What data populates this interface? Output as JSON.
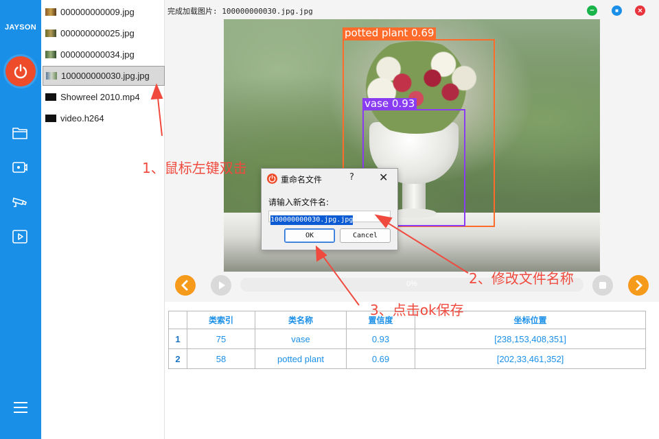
{
  "sidebar": {
    "brand": "JAYSON",
    "icons": [
      "power-icon",
      "folder-icon",
      "camera-icon",
      "cctv-icon",
      "play-icon",
      "menu-icon"
    ],
    "accent": "#1a8fe8",
    "power_color": "#ee4b2b"
  },
  "files": [
    {
      "name": "000000000009.jpg",
      "thumb": "image"
    },
    {
      "name": "000000000025.jpg",
      "thumb": "image"
    },
    {
      "name": "000000000034.jpg",
      "thumb": "image"
    },
    {
      "name": "100000000030.jpg.jpg",
      "thumb": "image",
      "selected": true
    },
    {
      "name": "Showreel 2010.mp4",
      "thumb": "video"
    },
    {
      "name": "video.h264",
      "thumb": "video"
    }
  ],
  "status": "完成加载图片: 100000000030.jpg.jpg",
  "window_buttons": {
    "minimize": "#18b44a",
    "maximize": "#1a8fe8",
    "close": "#e8343c"
  },
  "detections_overlay": [
    {
      "label": "potted plant 0.69",
      "color": "#ff6b2b"
    },
    {
      "label": "vase 0.93",
      "color": "#8a3cf2"
    }
  ],
  "player": {
    "progress_text": "0%",
    "progress": 0
  },
  "table": {
    "headers": [
      "",
      "类索引",
      "类名称",
      "置信度",
      "坐标位置"
    ],
    "rows": [
      {
        "idx": "1",
        "class_index": "75",
        "class_name": "vase",
        "confidence": "0.93",
        "coords": "[238,153,408,351]"
      },
      {
        "idx": "2",
        "class_index": "58",
        "class_name": "potted plant",
        "confidence": "0.69",
        "coords": "[202,33,461,352]"
      }
    ]
  },
  "dialog": {
    "title": "重命名文件",
    "help": "?",
    "close": "✕",
    "prompt": "请输入新文件名:",
    "value": "100000000030.jpg.jpg",
    "ok": "OK",
    "cancel": "Cancel"
  },
  "annotations": {
    "step1": "1、鼠标左键双击",
    "step2": "2、修改文件名称",
    "step3": "3、点击ok保存"
  }
}
